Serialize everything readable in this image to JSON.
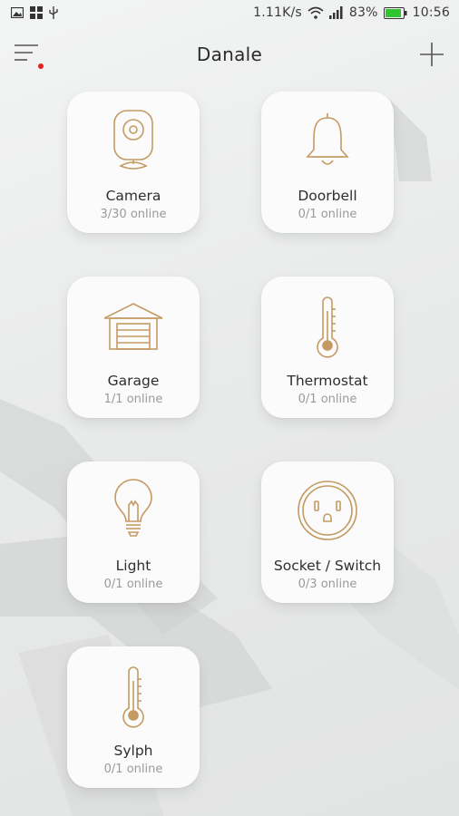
{
  "status_bar": {
    "net_speed": "1.11K/s",
    "battery": "83%",
    "time": "10:56",
    "icons": [
      "image-icon",
      "grid-icon",
      "usb-icon",
      "wifi-icon",
      "signal-icon",
      "battery-icon"
    ]
  },
  "header": {
    "title": "Danale",
    "menu_icon": "menu-icon",
    "add_icon": "plus-icon",
    "notification_color": "#e2231a"
  },
  "accent_color": "#c49a62",
  "devices": [
    {
      "name": "Camera",
      "status": "3/30 online",
      "icon": "camera-icon"
    },
    {
      "name": "Doorbell",
      "status": "0/1 online",
      "icon": "bell-icon"
    },
    {
      "name": "Garage",
      "status": "1/1 online",
      "icon": "garage-icon"
    },
    {
      "name": "Thermostat",
      "status": "0/1 online",
      "icon": "thermometer-icon"
    },
    {
      "name": "Light",
      "status": "0/1 online",
      "icon": "lightbulb-icon"
    },
    {
      "name": "Socket / Switch",
      "status": "0/3 online",
      "icon": "socket-icon"
    },
    {
      "name": "Sylph",
      "status": "0/1 online",
      "icon": "thermometer-icon"
    }
  ]
}
